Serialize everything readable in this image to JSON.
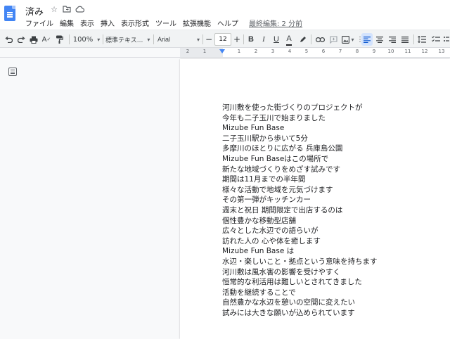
{
  "header": {
    "title": "済み",
    "last_edit": "最終編集: 2 分前"
  },
  "menu": [
    "ファイル",
    "編集",
    "表示",
    "挿入",
    "表示形式",
    "ツール",
    "拡張機能",
    "ヘルプ"
  ],
  "toolbar": {
    "zoom": "100%",
    "style": "標準テキス...",
    "font": "Arial",
    "font_size": "12",
    "bold": "B",
    "italic": "I",
    "underline": "U",
    "text_color": "A",
    "minus": "−",
    "plus": "+"
  },
  "ruler": {
    "numbers": [
      "2",
      "1",
      "1",
      "2",
      "3",
      "4",
      "5",
      "6",
      "7",
      "8",
      "9",
      "10",
      "11",
      "12",
      "13"
    ]
  },
  "document": {
    "lines": [
      "河川敷を使った街づくりのプロジェクトが",
      "今年も二子玉川で始まりました",
      "Mizube Fun Base",
      "二子玉川駅から歩いて5分",
      "多摩川のほとりに広がる 兵庫島公園",
      "Mizube Fun Baseはこの場所で",
      "新たな地域づくりをめざす試みです",
      "期間は11月までの半年間",
      "様々な活動で地域を元気づけます",
      "その第一弾がキッチンカー",
      "週末と祝日 期間限定で出店するのは",
      "個性豊かな移動型店舗",
      "広々とした水辺での語らいが",
      "訪れた人の 心や体を癒します",
      "Mizube Fun Base は",
      "水辺・楽しいこと・拠点という意味を持ちます",
      "河川敷は風水害の影響を受けやすく",
      "恒常的な利活用は難しいとされてきました",
      "活動を継続することで",
      "自然豊かな水辺を憩いの空間に変えたい",
      "試みには大きな願いが込められています"
    ]
  },
  "colors": {
    "accent": "#4285f4",
    "toolbar_bg": "#f1f3f4",
    "active_bg": "#d3e3fd"
  }
}
